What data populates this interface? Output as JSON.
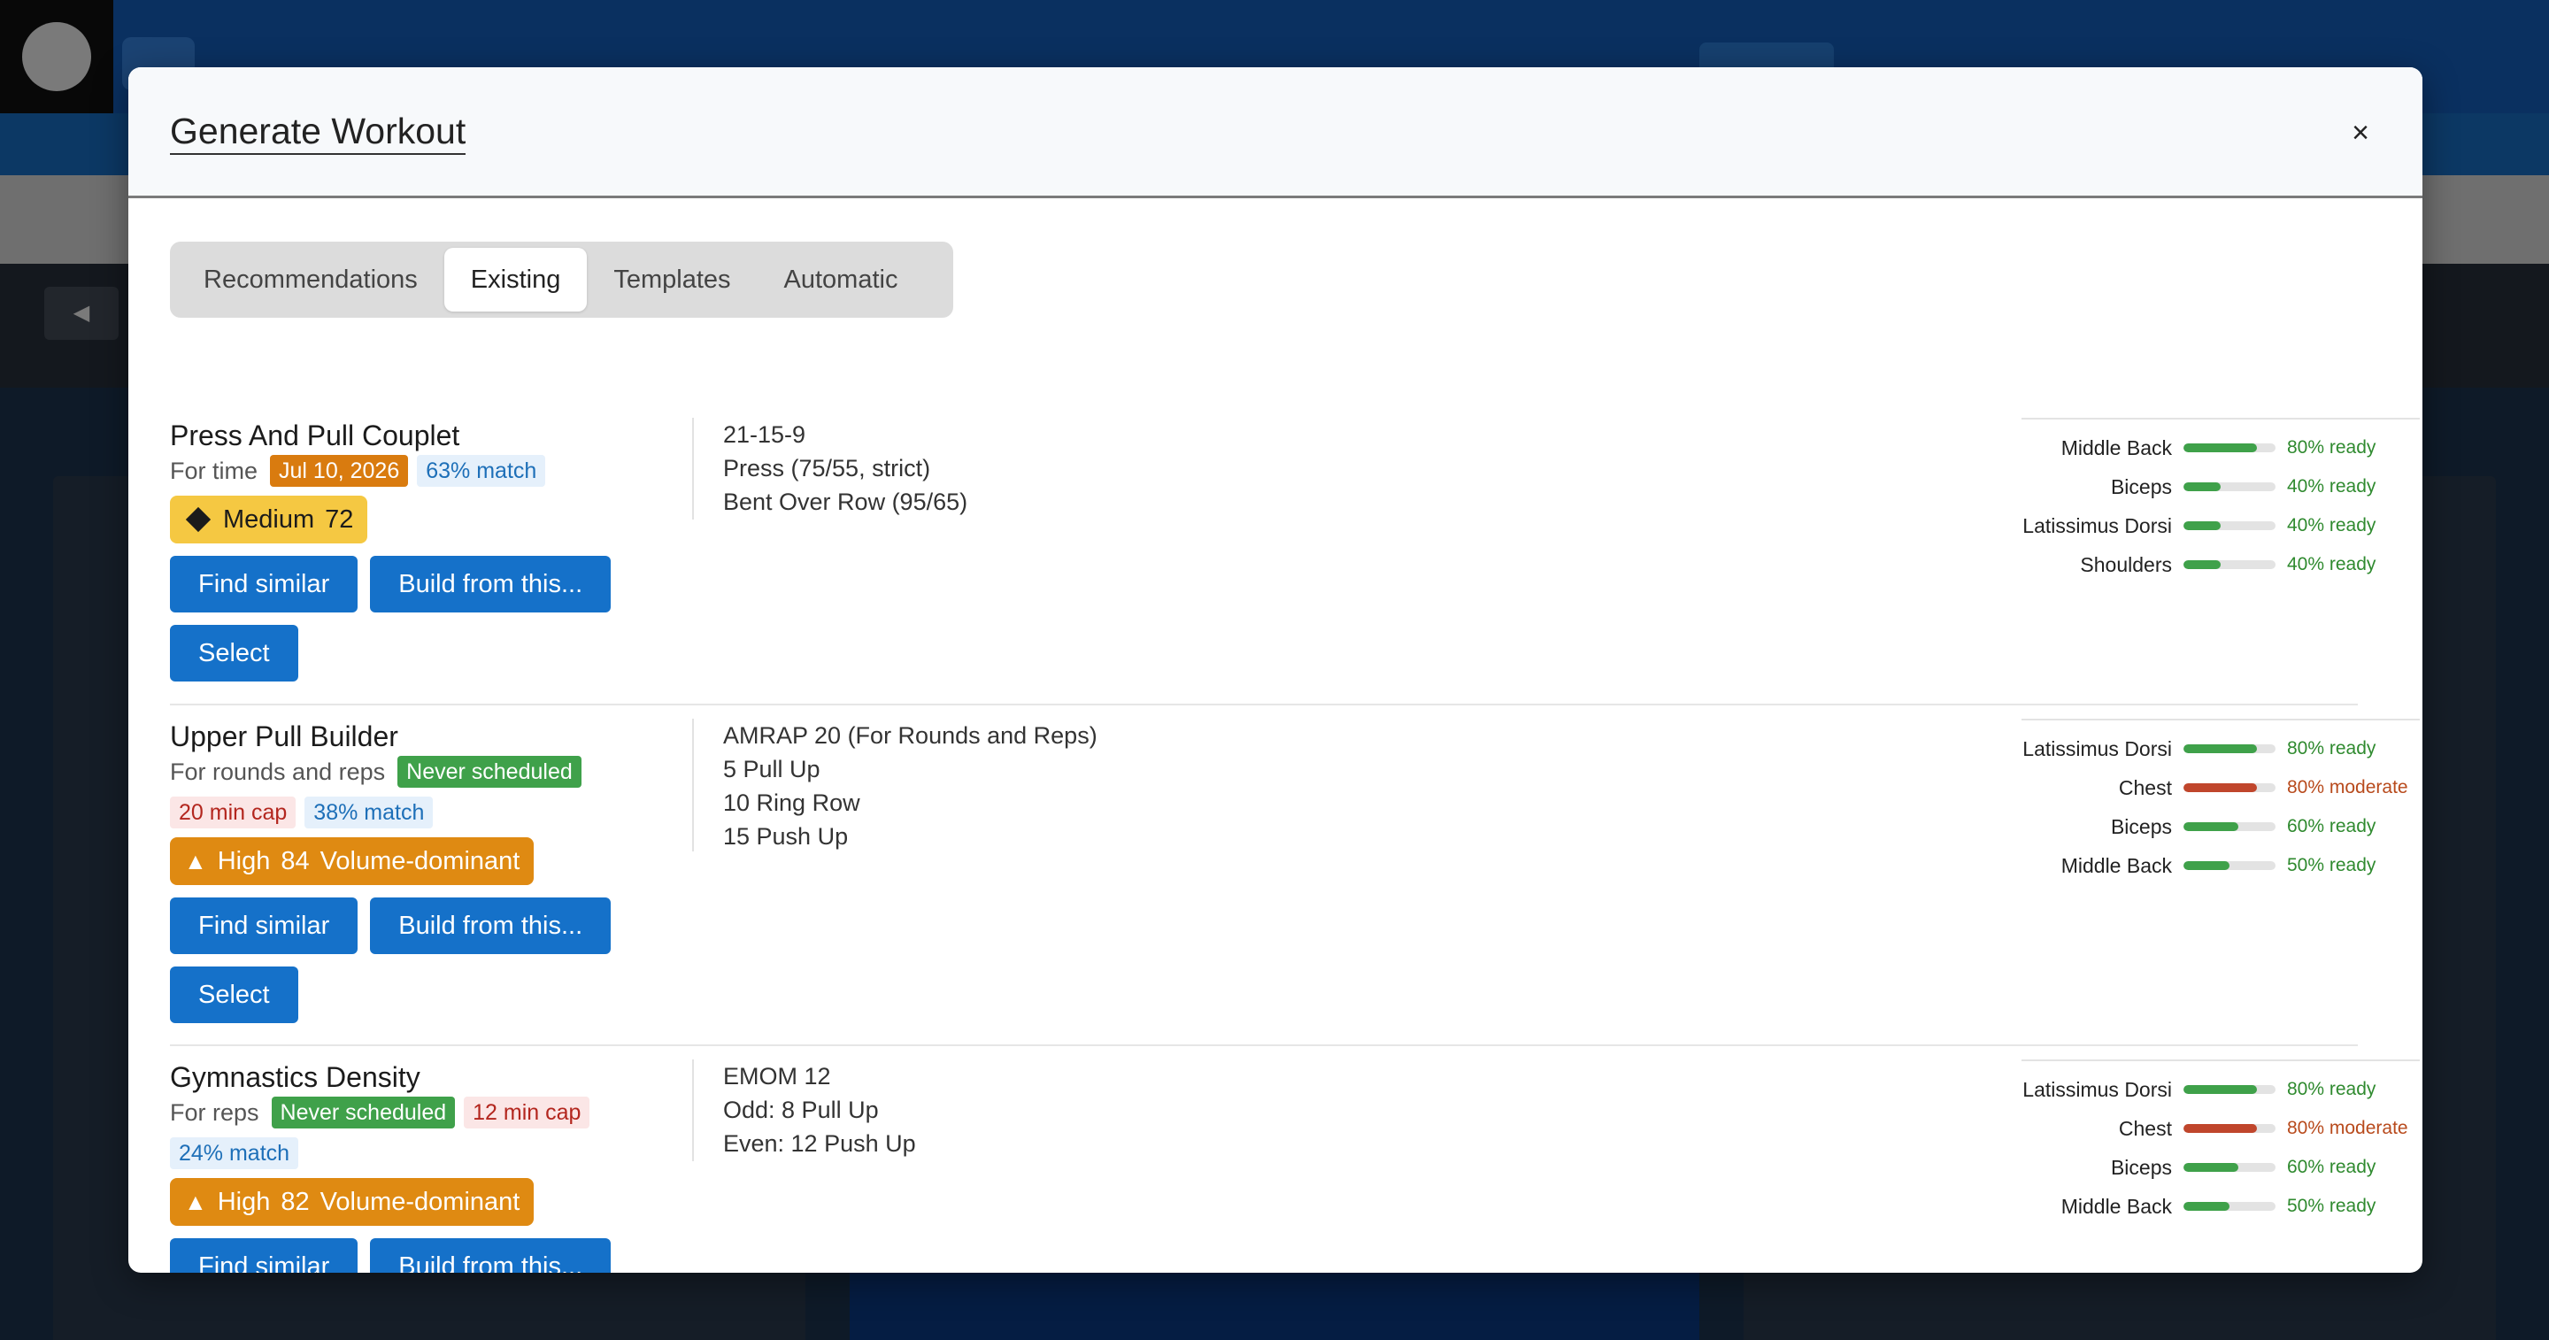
{
  "modal": {
    "title": "Generate Workout",
    "close_icon": "×"
  },
  "tabs": [
    {
      "label": "Recommendations",
      "active": false
    },
    {
      "label": "Existing",
      "active": true
    },
    {
      "label": "Templates",
      "active": false
    },
    {
      "label": "Automatic",
      "active": false
    }
  ],
  "colors": {
    "primary_button": "#1571c9",
    "ready_bar": "#3fa14a",
    "moderate_bar": "#c0462c",
    "medium_badge": "#f5c842",
    "high_badge": "#df8a12"
  },
  "workouts": [
    {
      "title": "Press And Pull Couplet",
      "meta_text": "For time",
      "date_tag": "Jul 10, 2026",
      "match_tag": "63% match",
      "intensity_label": "Medium",
      "intensity_value": "72",
      "find_similar": "Find similar",
      "build_from": "Build from this...",
      "select": "Select",
      "description": [
        "21-15-9",
        "Press (75/55, strict)",
        "Bent Over Row (95/65)"
      ],
      "muscles": [
        {
          "name": "Middle Back",
          "fill": 0.8,
          "status": "80% ready",
          "level": "ready"
        },
        {
          "name": "Biceps",
          "fill": 0.4,
          "status": "40% ready",
          "level": "ready"
        },
        {
          "name": "Latissimus Dorsi",
          "fill": 0.4,
          "status": "40% ready",
          "level": "ready"
        },
        {
          "name": "Shoulders",
          "fill": 0.4,
          "status": "40% ready",
          "level": "ready"
        }
      ]
    },
    {
      "title": "Upper Pull Builder",
      "meta_text": "For rounds and reps",
      "schedule_tag": "Never scheduled",
      "cap_tag": "20 min cap",
      "match_tag": "38% match",
      "intensity_label": "High",
      "intensity_value": "84",
      "intensity_extra": "Volume-dominant",
      "find_similar": "Find similar",
      "build_from": "Build from this...",
      "select": "Select",
      "description": [
        "AMRAP 20 (For Rounds and Reps)",
        "5 Pull Up",
        "10 Ring Row",
        "15 Push Up"
      ],
      "muscles": [
        {
          "name": "Latissimus Dorsi",
          "fill": 0.8,
          "status": "80% ready",
          "level": "ready"
        },
        {
          "name": "Chest",
          "fill": 0.8,
          "status": "80% moderate",
          "level": "moderate"
        },
        {
          "name": "Biceps",
          "fill": 0.6,
          "status": "60% ready",
          "level": "ready"
        },
        {
          "name": "Middle Back",
          "fill": 0.5,
          "status": "50% ready",
          "level": "ready"
        }
      ]
    },
    {
      "title": "Gymnastics Density",
      "meta_text": "For reps",
      "schedule_tag": "Never scheduled",
      "cap_tag": "12 min cap",
      "match_tag": "24% match",
      "intensity_label": "High",
      "intensity_value": "82",
      "intensity_extra": "Volume-dominant",
      "find_similar": "Find similar",
      "build_from": "Build from this...",
      "description": [
        "EMOM 12",
        "Odd: 8 Pull Up",
        "Even: 12 Push Up"
      ],
      "muscles": [
        {
          "name": "Latissimus Dorsi",
          "fill": 0.8,
          "status": "80% ready",
          "level": "ready"
        },
        {
          "name": "Chest",
          "fill": 0.8,
          "status": "80% moderate",
          "level": "moderate"
        },
        {
          "name": "Biceps",
          "fill": 0.6,
          "status": "60% ready",
          "level": "ready"
        },
        {
          "name": "Middle Back",
          "fill": 0.5,
          "status": "50% ready",
          "level": "ready"
        }
      ]
    }
  ]
}
